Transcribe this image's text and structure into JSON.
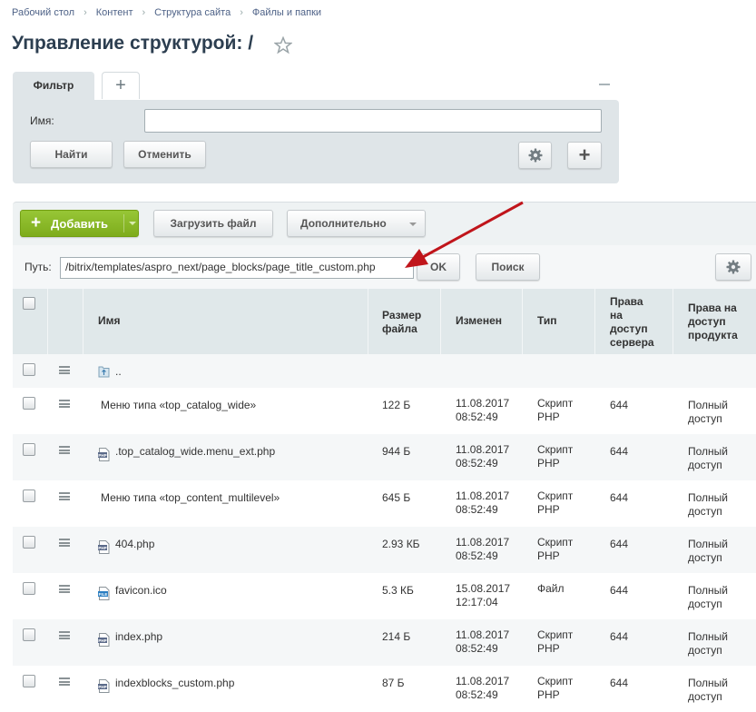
{
  "breadcrumbs": [
    "Рабочий стол",
    "Контент",
    "Структура сайта",
    "Файлы и папки"
  ],
  "page_title": "Управление структурой: /",
  "filter": {
    "tab_label": "Фильтр",
    "add_tab_label": "+",
    "name_label": "Имя:",
    "name_value": "",
    "find_label": "Найти",
    "cancel_label": "Отменить",
    "add_label": "+"
  },
  "toolbar": {
    "add_label": "Добавить",
    "upload_label": "Загрузить файл",
    "more_label": "Дополнительно"
  },
  "path": {
    "label": "Путь:",
    "value": "/bitrix/templates/aspro_next/page_blocks/page_title_custom.php",
    "ok_label": "OK",
    "search_label": "Поиск"
  },
  "table": {
    "headers": {
      "name": "Имя",
      "size": [
        "Размер",
        "файла"
      ],
      "changed": "Изменен",
      "type": "Тип",
      "server_rights": [
        "Права",
        "на",
        "доступ",
        "сервера"
      ],
      "product_rights": [
        "Права на",
        "доступ",
        "продукта"
      ]
    },
    "parent_label": "..",
    "rows": [
      {
        "name": "Меню типа «top_catalog_wide»",
        "icon": "none",
        "size": "122 Б",
        "date": "11.08.2017",
        "time": "08:52:49",
        "type": [
          "Скрипт",
          "PHP"
        ],
        "server": "644",
        "product": [
          "Полный",
          "доступ"
        ]
      },
      {
        "name": ".top_catalog_wide.menu_ext.php",
        "icon": "php-file-icon",
        "size": "944 Б",
        "date": "11.08.2017",
        "time": "08:52:49",
        "type": [
          "Скрипт",
          "PHP"
        ],
        "server": "644",
        "product": [
          "Полный",
          "доступ"
        ]
      },
      {
        "name": "Меню типа «top_content_multilevel»",
        "icon": "none",
        "size": "645 Б",
        "date": "11.08.2017",
        "time": "08:52:49",
        "type": [
          "Скрипт",
          "PHP"
        ],
        "server": "644",
        "product": [
          "Полный",
          "доступ"
        ]
      },
      {
        "name": "404.php",
        "icon": "php-file-icon",
        "size": "2.93 КБ",
        "date": "11.08.2017",
        "time": "08:52:49",
        "type": [
          "Скрипт",
          "PHP"
        ],
        "server": "644",
        "product": [
          "Полный",
          "доступ"
        ]
      },
      {
        "name": "favicon.ico",
        "icon": "generic-file-icon",
        "size": "5.3 КБ",
        "date": "15.08.2017",
        "time": "12:17:04",
        "type": [
          "Файл",
          ""
        ],
        "server": "644",
        "product": [
          "Полный",
          "доступ"
        ]
      },
      {
        "name": "index.php",
        "icon": "php-file-icon",
        "size": "214 Б",
        "date": "11.08.2017",
        "time": "08:52:49",
        "type": [
          "Скрипт",
          "PHP"
        ],
        "server": "644",
        "product": [
          "Полный",
          "доступ"
        ]
      },
      {
        "name": "indexblocks_custom.php",
        "icon": "php-file-icon",
        "size": "87 Б",
        "date": "11.08.2017",
        "time": "08:52:49",
        "type": [
          "Скрипт",
          "PHP"
        ],
        "server": "644",
        "product": [
          "Полный",
          "доступ"
        ]
      }
    ]
  },
  "colors": {
    "accent_green": "#86b723",
    "link_blue": "#4e6287",
    "annotation_arrow": "#c0151b"
  }
}
